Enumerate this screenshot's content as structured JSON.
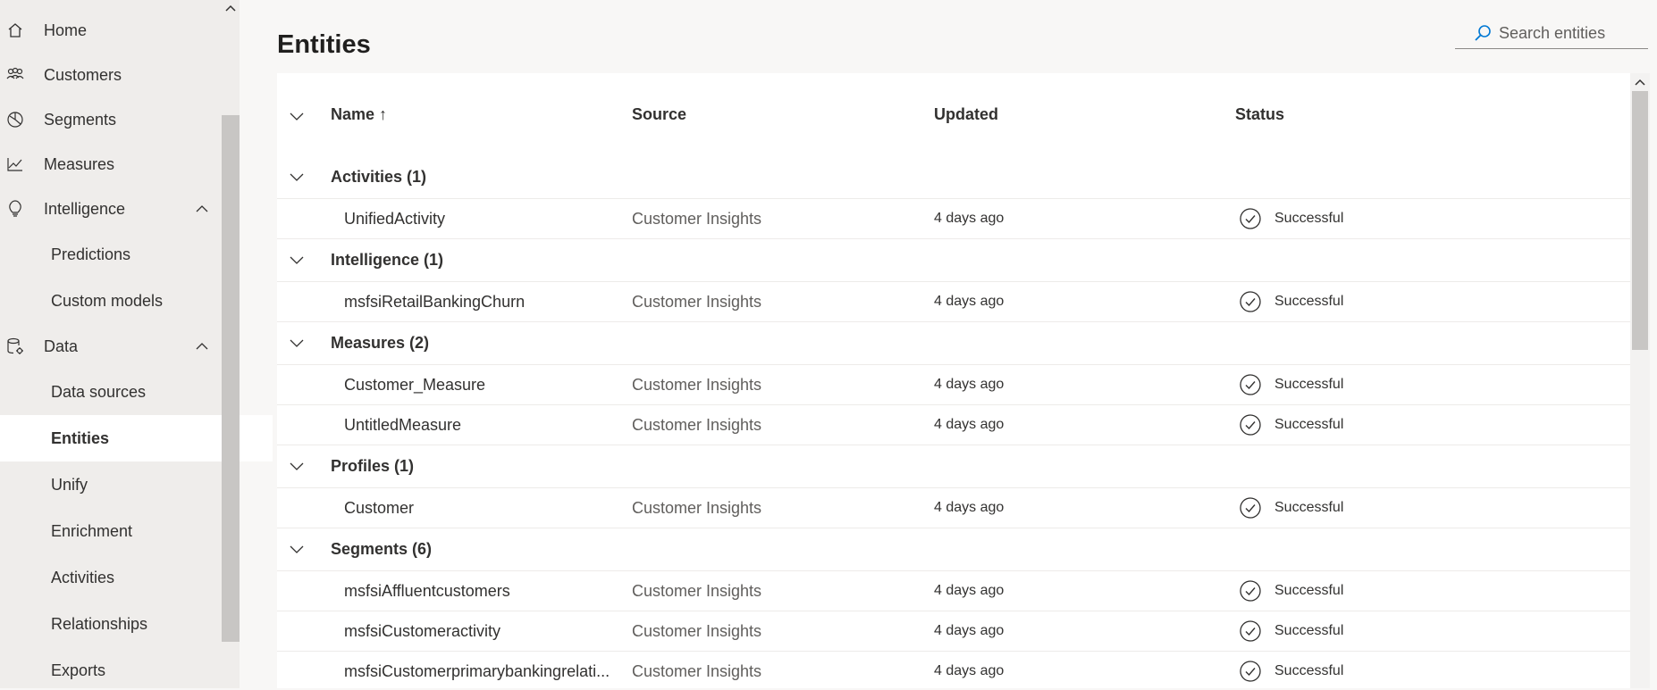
{
  "sidebar": {
    "items": [
      {
        "label": "Home",
        "icon": "home-icon"
      },
      {
        "label": "Customers",
        "icon": "people-icon"
      },
      {
        "label": "Segments",
        "icon": "segments-icon"
      },
      {
        "label": "Measures",
        "icon": "chart-line-icon"
      },
      {
        "label": "Intelligence",
        "icon": "lightbulb-icon",
        "expanded": true
      },
      {
        "label": "Predictions"
      },
      {
        "label": "Custom models"
      },
      {
        "label": "Data",
        "icon": "database-gear-icon",
        "expanded": true
      },
      {
        "label": "Data sources"
      },
      {
        "label": "Entities",
        "active": true
      },
      {
        "label": "Unify"
      },
      {
        "label": "Enrichment"
      },
      {
        "label": "Activities"
      },
      {
        "label": "Relationships"
      },
      {
        "label": "Exports"
      }
    ]
  },
  "page": {
    "title": "Entities"
  },
  "search": {
    "placeholder": "Search entities",
    "value": ""
  },
  "table": {
    "columns": {
      "name": "Name ↑",
      "source": "Source",
      "updated": "Updated",
      "status": "Status"
    },
    "groups": [
      {
        "label": "Activities (1)",
        "rows": [
          {
            "name": "UnifiedActivity",
            "source": "Customer Insights",
            "updated": "4 days ago",
            "status": "Successful"
          }
        ]
      },
      {
        "label": "Intelligence (1)",
        "rows": [
          {
            "name": "msfsiRetailBankingChurn",
            "source": "Customer Insights",
            "updated": "4 days ago",
            "status": "Successful"
          }
        ]
      },
      {
        "label": "Measures (2)",
        "rows": [
          {
            "name": "Customer_Measure",
            "source": "Customer Insights",
            "updated": "4 days ago",
            "status": "Successful"
          },
          {
            "name": "UntitledMeasure",
            "source": "Customer Insights",
            "updated": "4 days ago",
            "status": "Successful"
          }
        ]
      },
      {
        "label": "Profiles (1)",
        "rows": [
          {
            "name": "Customer",
            "source": "Customer Insights",
            "updated": "4 days ago",
            "status": "Successful"
          }
        ]
      },
      {
        "label": "Segments (6)",
        "rows": [
          {
            "name": "msfsiAffluentcustomers",
            "source": "Customer Insights",
            "updated": "4 days ago",
            "status": "Successful"
          },
          {
            "name": "msfsiCustomeractivity",
            "source": "Customer Insights",
            "updated": "4 days ago",
            "status": "Successful"
          },
          {
            "name": "msfsiCustomerprimarybankingrelati...",
            "source": "Customer Insights",
            "updated": "4 days ago",
            "status": "Successful"
          }
        ]
      }
    ]
  },
  "colors": {
    "accent": "#0078d4",
    "sidebar_bg": "#efedeb",
    "page_bg": "#f8f7f6",
    "active_item_bg": "#ffffff"
  }
}
